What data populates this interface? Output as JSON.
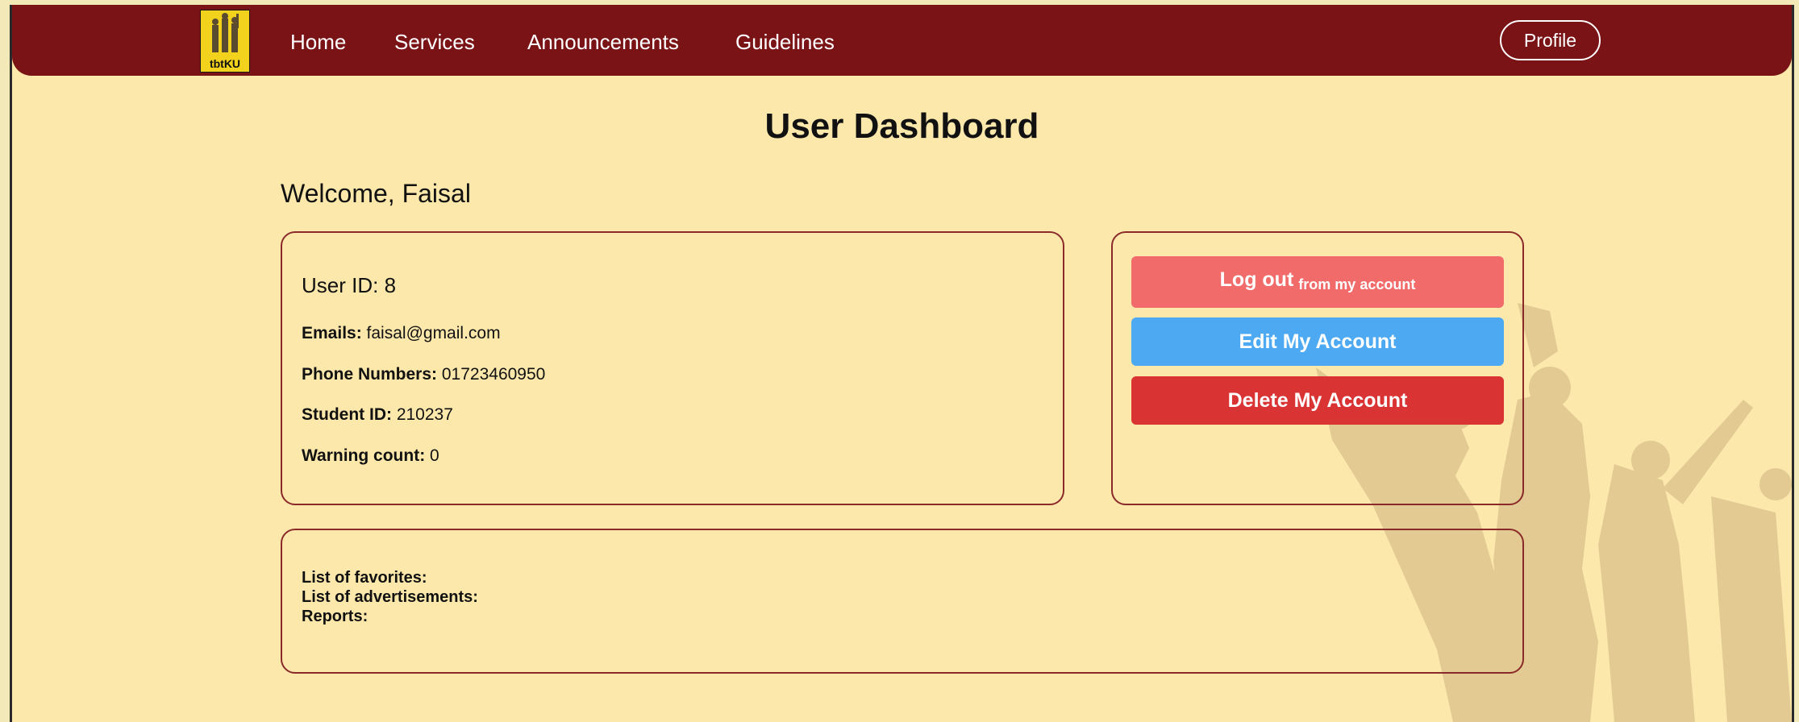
{
  "nav": {
    "logo_text": "tbtKU",
    "links": [
      "Home",
      "Services",
      "Announcements",
      "Guidelines"
    ],
    "profile_label": "Profile"
  },
  "page": {
    "title": "User Dashboard",
    "welcome": "Welcome, Faisal"
  },
  "user": {
    "id_label": "User ID: 8",
    "emails_label": "Emails:",
    "emails_value": "faisal@gmail.com",
    "phone_label": "Phone Numbers:",
    "phone_value": "01723460950",
    "student_label": "Student ID:",
    "student_value": "210237",
    "warning_label": "Warning count:",
    "warning_value": "0"
  },
  "actions": {
    "logout_main": "Log out",
    "logout_sub": "from my account",
    "edit": "Edit My Account",
    "delete": "Delete My Account"
  },
  "lists": {
    "favorites": "List of favorites:",
    "advertisements": "List of advertisements:",
    "reports": "Reports:"
  },
  "colors": {
    "navbar": "#7a1315",
    "page_bg": "#fde8ac",
    "logout": "#f26b6b",
    "edit": "#4da9f2",
    "delete": "#d93333"
  }
}
